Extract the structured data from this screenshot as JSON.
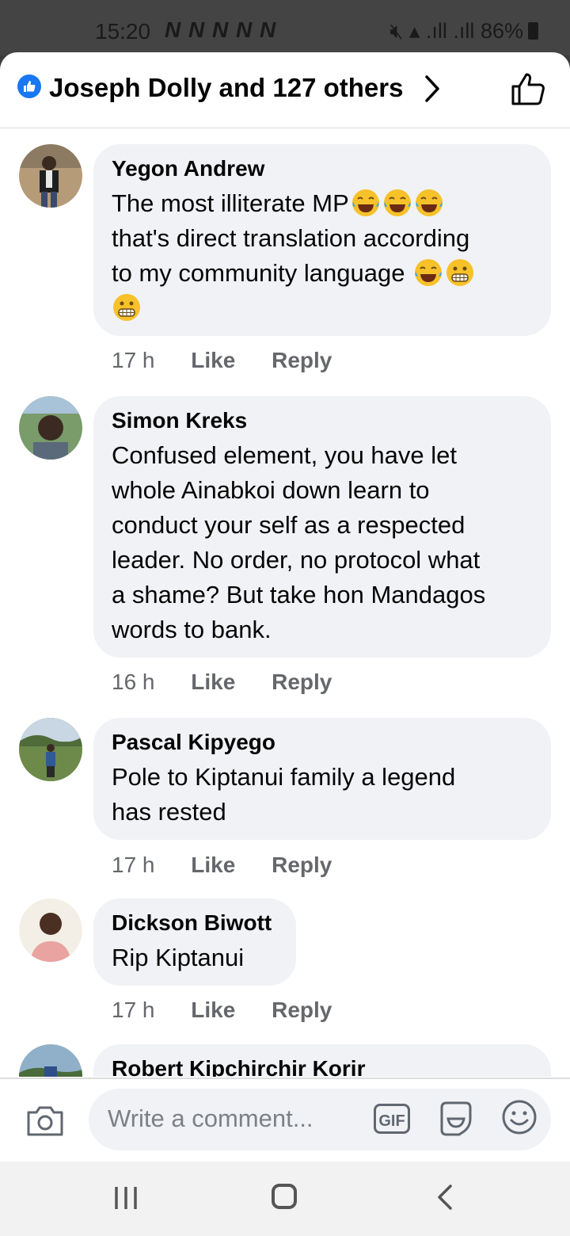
{
  "status_bar": {
    "time": "15:20",
    "notif_icons": "N N N N N",
    "dot": "•",
    "battery": "86%"
  },
  "header": {
    "title": "Joseph Dolly and 127 others"
  },
  "comments": [
    {
      "name": "Yegon Andrew",
      "text": "The most illiterate MP",
      "text2": "that's direct translation according\nto my community language ",
      "time": "17 h",
      "like": "Like",
      "reply": "Reply"
    },
    {
      "name": "Simon Kreks",
      "text": "Confused element, you have let\nwhole Ainabkoi down learn to\nconduct your self as a respected\nleader. No order, no protocol what\na shame? But take hon Mandagos\nwords to bank.",
      "time": "16 h",
      "like": "Like",
      "reply": "Reply"
    },
    {
      "name": "Pascal Kipyego",
      "text": "Pole to Kiptanui family a legend\nhas rested",
      "time": "17 h",
      "like": "Like",
      "reply": "Reply"
    },
    {
      "name": "Dickson Biwott",
      "text": "Rip Kiptanui",
      "time": "17 h",
      "like": "Like",
      "reply": "Reply"
    },
    {
      "name": "Robert Kipchirchir Korir"
    }
  ],
  "composer": {
    "placeholder": "Write a comment...",
    "gif_label": "GIF"
  },
  "colors": {
    "accent": "#1877f2",
    "bubble": "#f0f2f5",
    "meta": "#65676b"
  }
}
